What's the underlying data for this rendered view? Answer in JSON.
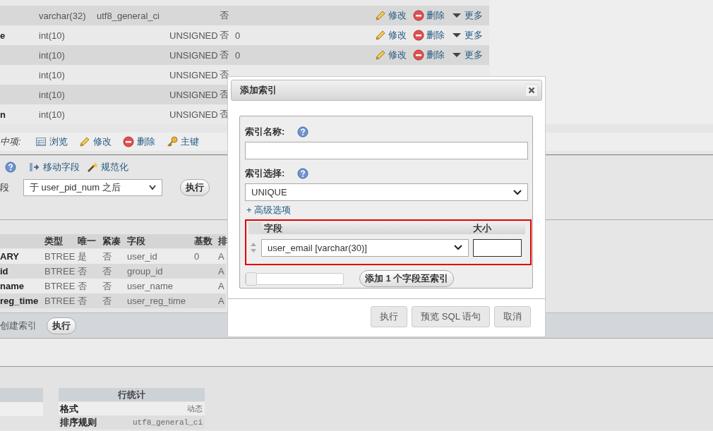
{
  "structure_rows": [
    {
      "name": "",
      "type": "varchar(32)",
      "collation": "utf8_general_ci",
      "attributes": "",
      "null": "否",
      "default": "",
      "actions": [
        "修改",
        "删除",
        "更多"
      ]
    },
    {
      "name": "e",
      "type": "int(10)",
      "collation": "",
      "attributes": "UNSIGNED",
      "null": "否",
      "default": "0",
      "actions": [
        "修改",
        "删除",
        "更多"
      ]
    },
    {
      "name": "",
      "type": "int(10)",
      "collation": "",
      "attributes": "UNSIGNED",
      "null": "否",
      "default": "0",
      "actions": [
        "修改",
        "删除",
        "更多"
      ]
    },
    {
      "name": "",
      "type": "int(10)",
      "collation": "",
      "attributes": "UNSIGNED",
      "null": "否",
      "default": "",
      "actions": []
    },
    {
      "name": "",
      "type": "int(10)",
      "collation": "",
      "attributes": "UNSIGNED",
      "null": "否",
      "default": "",
      "actions": []
    },
    {
      "name": "n",
      "type": "int(10)",
      "collation": "",
      "attributes": "UNSIGNED",
      "null": "否",
      "default": "",
      "actions": []
    }
  ],
  "selection_toolbar": {
    "label": "中项:",
    "actions": [
      {
        "kind": "browse",
        "label": "浏览"
      },
      {
        "kind": "edit",
        "label": "修改"
      },
      {
        "kind": "delete",
        "label": "删除"
      },
      {
        "kind": "key",
        "label": "主键"
      }
    ]
  },
  "move_bar": {
    "actions": [
      {
        "kind": "move",
        "label": "移动字段"
      },
      {
        "kind": "normalize",
        "label": "规范化"
      }
    ]
  },
  "add_field": {
    "label": "段",
    "position": "于 user_pid_num 之后",
    "button": "执行"
  },
  "indexes": {
    "columns": [
      "",
      "类型",
      "唯一",
      "紧凑",
      "字段",
      "基数",
      "排"
    ],
    "rows": [
      [
        "ARY",
        "BTREE",
        "是",
        "否",
        "user_id",
        "0",
        "A"
      ],
      [
        "id",
        "BTREE",
        "否",
        "否",
        "group_id",
        "",
        "A"
      ],
      [
        "name",
        "BTREE",
        "否",
        "否",
        "user_name",
        "",
        "A"
      ],
      [
        "reg_time",
        "BTREE",
        "否",
        "否",
        "user_reg_time",
        "",
        "A"
      ]
    ]
  },
  "create_index": {
    "label": "创建索引",
    "button": "执行"
  },
  "row_stats": {
    "title": "行统计",
    "rows": [
      [
        "格式",
        "动态"
      ],
      [
        "排序规则",
        "utf8_general_ci"
      ]
    ]
  },
  "dialog": {
    "title": "添加索引",
    "name_label": "索引名称:",
    "type_label": "索引选择:",
    "type_value": "UNIQUE",
    "advanced_link": "+ 高级选项",
    "columns_header": [
      "字段",
      "大小"
    ],
    "column_value": "user_email [varchar(30)]",
    "count_slider": {
      "level": 0
    },
    "add_button": "添加 1 个字段至索引",
    "buttons": [
      "执行",
      "预览 SQL 语句",
      "取消"
    ]
  }
}
